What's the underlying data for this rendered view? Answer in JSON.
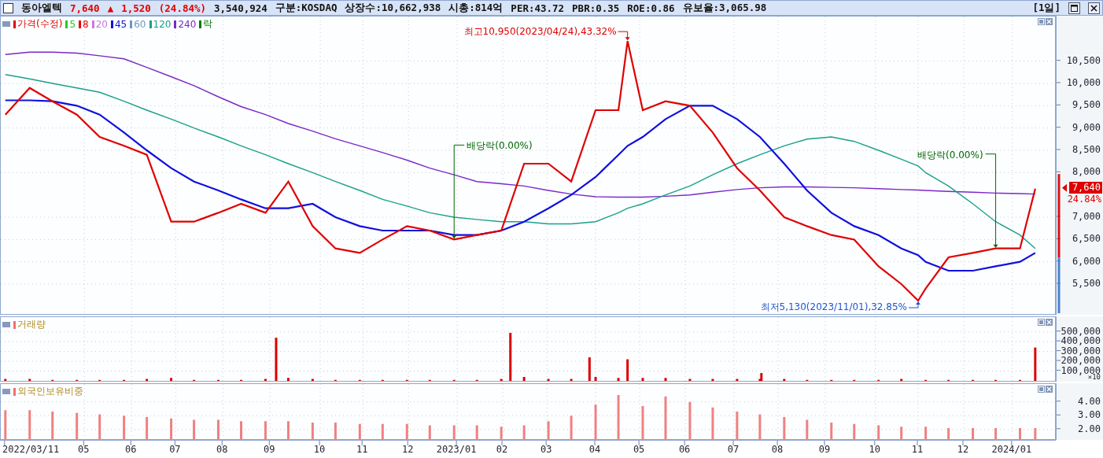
{
  "header": {
    "checked": false,
    "name": "동아엘텍",
    "price": "7,640",
    "change_sign": "▲",
    "change": "1,520",
    "change_pct": "(24.84%)",
    "volume": "3,540,924",
    "stats": [
      "구분:KOSDAQ",
      "상장수:10,662,938",
      "시총:814억",
      "PER:43.72",
      "PBR:0.35",
      "ROE:0.86",
      "유보율:3,065.98"
    ],
    "period": "[1일]"
  },
  "price_panel": {
    "legend": [
      {
        "label": "가격(수정)",
        "color": "#e00000"
      },
      {
        "label": "5",
        "color": "#22cc22"
      },
      {
        "label": "8",
        "color": "#ee0000"
      },
      {
        "label": "20",
        "color": "#cc77dd"
      },
      {
        "label": "45",
        "color": "#1010dd"
      },
      {
        "label": "60",
        "color": "#6a98c8"
      },
      {
        "label": "120",
        "color": "#1aa08a"
      },
      {
        "label": "240",
        "color": "#7a28c8"
      },
      {
        "label": "락",
        "color": "#007a00"
      }
    ],
    "current": {
      "price": "7,640",
      "percent": "24.84%"
    },
    "chart_data": {
      "type": "line",
      "grid": true,
      "xlim": [
        "2022-03-08",
        "2024-01-30"
      ],
      "ylim": [
        4830,
        11500
      ],
      "x": [
        "2022-03-11",
        "2022-03-27",
        "2022-04-11",
        "2022-04-27",
        "2022-05-12",
        "2022-05-28",
        "2022-06-12",
        "2022-06-28",
        "2022-07-13",
        "2022-07-29",
        "2022-08-13",
        "2022-08-29",
        "2022-09-13",
        "2022-09-29",
        "2022-10-14",
        "2022-10-30",
        "2022-11-14",
        "2022-11-30",
        "2022-12-15",
        "2022-12-31",
        "2023-01-15",
        "2023-01-31",
        "2023-02-15",
        "2023-03-03",
        "2023-03-18",
        "2023-04-03",
        "2023-04-18",
        "2023-04-24",
        "2023-05-04",
        "2023-05-19",
        "2023-06-04",
        "2023-06-19",
        "2023-07-05",
        "2023-07-20",
        "2023-08-05",
        "2023-08-20",
        "2023-09-05",
        "2023-09-20",
        "2023-10-06",
        "2023-10-21",
        "2023-11-01",
        "2023-11-06",
        "2023-11-21",
        "2023-12-07",
        "2023-12-22",
        "2024-01-07",
        "2024-01-17"
      ],
      "yticks": [
        {
          "value": 5500,
          "label": "5,500"
        },
        {
          "value": 6000,
          "label": "6,000"
        },
        {
          "value": 6500,
          "label": "6,500"
        },
        {
          "value": 7000,
          "label": "7,000"
        },
        {
          "value": 8000,
          "label": "8,000"
        },
        {
          "value": 8500,
          "label": "8,500"
        },
        {
          "value": 9000,
          "label": "9,000"
        },
        {
          "value": 9500,
          "label": "9,500"
        },
        {
          "value": 10000,
          "label": "10,000"
        },
        {
          "value": 10500,
          "label": "10,500"
        }
      ],
      "series": [
        {
          "color": "#7a28c8",
          "values": [
            10650,
            10700,
            10700,
            10680,
            10620,
            10550,
            10360,
            10150,
            9950,
            9700,
            9480,
            9300,
            9100,
            8930,
            8760,
            8600,
            8450,
            8280,
            8100,
            7950,
            7800,
            7750,
            7700,
            7600,
            7520,
            7460,
            7450,
            7450,
            7450,
            7470,
            7500,
            7560,
            7620,
            7660,
            7680,
            7680,
            7670,
            7660,
            7640,
            7620,
            7610,
            7600,
            7580,
            7560,
            7540,
            7530,
            7520
          ]
        },
        {
          "color": "#1aa08a",
          "values": [
            10200,
            10100,
            10000,
            9900,
            9800,
            9600,
            9400,
            9200,
            9000,
            8800,
            8600,
            8400,
            8200,
            8000,
            7800,
            7600,
            7400,
            7250,
            7100,
            7000,
            6950,
            6900,
            6900,
            6850,
            6850,
            6900,
            7100,
            7200,
            7300,
            7500,
            7700,
            7950,
            8200,
            8400,
            8600,
            8750,
            8800,
            8700,
            8500,
            8300,
            8150,
            8000,
            7700,
            7300,
            6900,
            6600,
            6300
          ]
        },
        {
          "color": "#1010dd",
          "values": [
            9620,
            9620,
            9600,
            9500,
            9300,
            8900,
            8500,
            8100,
            7800,
            7600,
            7400,
            7200,
            7200,
            7300,
            7000,
            6800,
            6700,
            6700,
            6700,
            6600,
            6600,
            6700,
            6900,
            7200,
            7500,
            7900,
            8400,
            8600,
            8800,
            9200,
            9500,
            9500,
            9200,
            8800,
            8200,
            7600,
            7100,
            6800,
            6600,
            6300,
            6150,
            6000,
            5800,
            5800,
            5900,
            6000,
            6200
          ]
        },
        {
          "color": "#e00000",
          "values": [
            9300,
            9900,
            9600,
            9300,
            8800,
            8600,
            8400,
            6900,
            6900,
            7100,
            7300,
            7100,
            7800,
            6800,
            6300,
            6200,
            6500,
            6800,
            6700,
            6500,
            6600,
            6700,
            8200,
            8200,
            7800,
            9400,
            9400,
            10950,
            9400,
            9600,
            9500,
            8900,
            8100,
            7600,
            7000,
            6800,
            6600,
            6500,
            5900,
            5500,
            5130,
            5400,
            6100,
            6200,
            6300,
            6300,
            7640
          ]
        }
      ],
      "annotations": [
        {
          "text": "최고10,950(2023/04/24),43.32%",
          "x": "2023-04-24",
          "y": 10950
        },
        {
          "text": "배당락(0.00%)",
          "x": "2022-12-31",
          "y": 6500
        },
        {
          "text": "배당락(0.00%)",
          "x": "2023-12-22",
          "y": 6300
        },
        {
          "text": "최저5,130(2023/11/01),32.85%",
          "x": "2023-11-01",
          "y": 5130
        }
      ]
    }
  },
  "volume_panel": {
    "title": "거래량",
    "unit": "×10",
    "chart_data": {
      "type": "bar",
      "grid": true,
      "xlim": [
        "2022-03-08",
        "2024-01-30"
      ],
      "ylim": [
        0,
        650000
      ],
      "x": [
        "2022-03-11",
        "2022-03-27",
        "2022-04-11",
        "2022-04-27",
        "2022-05-12",
        "2022-05-28",
        "2022-06-12",
        "2022-06-28",
        "2022-07-13",
        "2022-07-29",
        "2022-08-13",
        "2022-08-29",
        "2022-09-05",
        "2022-09-13",
        "2022-09-29",
        "2022-10-14",
        "2022-10-30",
        "2022-11-14",
        "2022-11-30",
        "2022-12-15",
        "2022-12-31",
        "2023-01-15",
        "2023-01-31",
        "2023-02-06",
        "2023-02-15",
        "2023-03-03",
        "2023-03-18",
        "2023-03-30",
        "2023-04-03",
        "2023-04-18",
        "2023-04-24",
        "2023-05-04",
        "2023-05-19",
        "2023-06-04",
        "2023-06-19",
        "2023-07-05",
        "2023-07-20",
        "2023-07-21",
        "2023-08-05",
        "2023-08-20",
        "2023-09-05",
        "2023-09-20",
        "2023-10-06",
        "2023-10-21",
        "2023-11-06",
        "2023-11-21",
        "2023-12-07",
        "2023-12-22",
        "2024-01-07",
        "2024-01-17"
      ],
      "yticks": [
        {
          "value": 100000,
          "label": "100,000"
        },
        {
          "value": 200000,
          "label": "200,000"
        },
        {
          "value": 300000,
          "label": "300,000"
        },
        {
          "value": 400000,
          "label": "400,000"
        },
        {
          "value": 500000,
          "label": "500,000"
        }
      ],
      "series": [
        {
          "color": "#dd0000",
          "values": [
            20000,
            20000,
            10000,
            10000,
            10000,
            10000,
            20000,
            30000,
            10000,
            10000,
            10000,
            20000,
            440000,
            30000,
            20000,
            10000,
            10000,
            10000,
            10000,
            10000,
            10000,
            10000,
            20000,
            490000,
            40000,
            20000,
            20000,
            240000,
            40000,
            30000,
            220000,
            30000,
            30000,
            20000,
            20000,
            20000,
            20000,
            80000,
            20000,
            10000,
            10000,
            10000,
            10000,
            20000,
            10000,
            10000,
            10000,
            10000,
            10000,
            340000
          ]
        }
      ]
    }
  },
  "foreign_panel": {
    "title": "외국인보유비중",
    "date_axis_start": "2022/03/11",
    "chart_data": {
      "type": "bar",
      "grid": true,
      "xlim": [
        "2022-03-08",
        "2024-01-30"
      ],
      "ylim": [
        1.3,
        5.3
      ],
      "x": [
        "2022-03-11",
        "2022-03-27",
        "2022-04-11",
        "2022-04-27",
        "2022-05-12",
        "2022-05-28",
        "2022-06-12",
        "2022-06-28",
        "2022-07-13",
        "2022-07-29",
        "2022-08-13",
        "2022-08-29",
        "2022-09-13",
        "2022-09-29",
        "2022-10-14",
        "2022-10-30",
        "2022-11-14",
        "2022-11-30",
        "2022-12-15",
        "2022-12-31",
        "2023-01-15",
        "2023-01-31",
        "2023-02-15",
        "2023-03-03",
        "2023-03-18",
        "2023-04-03",
        "2023-04-18",
        "2023-05-04",
        "2023-05-19",
        "2023-06-04",
        "2023-06-19",
        "2023-07-05",
        "2023-07-20",
        "2023-08-05",
        "2023-08-20",
        "2023-09-05",
        "2023-09-20",
        "2023-10-06",
        "2023-10-21",
        "2023-11-06",
        "2023-11-21",
        "2023-12-07",
        "2023-12-22",
        "2024-01-07",
        "2024-01-17"
      ],
      "xticks": [
        {
          "value": "2022-05-02",
          "label": "05"
        },
        {
          "value": "2022-06-02",
          "label": "06"
        },
        {
          "value": "2022-07-01",
          "label": "07"
        },
        {
          "value": "2022-08-01",
          "label": "08"
        },
        {
          "value": "2022-09-01",
          "label": "09"
        },
        {
          "value": "2022-10-04",
          "label": "10"
        },
        {
          "value": "2022-11-01",
          "label": "11"
        },
        {
          "value": "2022-12-01",
          "label": "12"
        },
        {
          "value": "2023-01-02",
          "label": "2023/01"
        },
        {
          "value": "2023-02-01",
          "label": "02"
        },
        {
          "value": "2023-03-02",
          "label": "03"
        },
        {
          "value": "2023-04-03",
          "label": "04"
        },
        {
          "value": "2023-05-02",
          "label": "05"
        },
        {
          "value": "2023-06-01",
          "label": "06"
        },
        {
          "value": "2023-07-03",
          "label": "07"
        },
        {
          "value": "2023-08-01",
          "label": "08"
        },
        {
          "value": "2023-09-01",
          "label": "09"
        },
        {
          "value": "2023-10-04",
          "label": "10"
        },
        {
          "value": "2023-11-01",
          "label": "11"
        },
        {
          "value": "2023-12-01",
          "label": "12"
        },
        {
          "value": "2024-01-02",
          "label": "2024/01"
        }
      ],
      "yticks": [
        {
          "value": 2,
          "label": "2.00"
        },
        {
          "value": 3,
          "label": "3.00"
        },
        {
          "value": 4,
          "label": "4.00"
        }
      ],
      "series": [
        {
          "color": "#f08080",
          "values": [
            3.4,
            3.4,
            3.3,
            3.2,
            3.1,
            3.0,
            2.9,
            2.8,
            2.7,
            2.7,
            2.6,
            2.6,
            2.6,
            2.5,
            2.5,
            2.4,
            2.4,
            2.4,
            2.3,
            2.3,
            2.3,
            2.2,
            2.3,
            2.6,
            3.0,
            3.8,
            4.5,
            3.7,
            4.4,
            4.0,
            3.6,
            3.3,
            3.1,
            2.9,
            2.7,
            2.5,
            2.4,
            2.3,
            2.2,
            2.2,
            2.1,
            2.1,
            2.1,
            2.1,
            2.1
          ]
        }
      ]
    }
  }
}
